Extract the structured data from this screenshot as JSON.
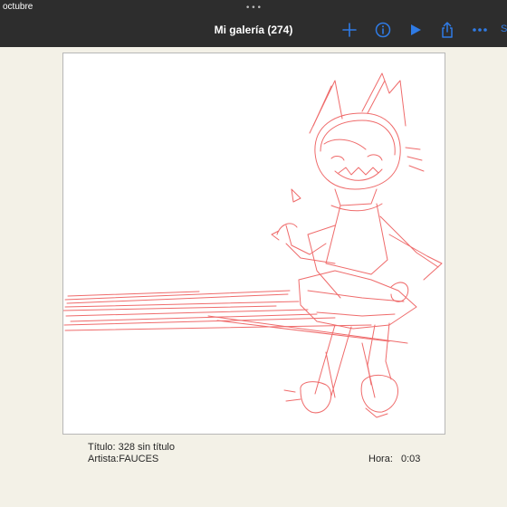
{
  "status_bar": {
    "left_label": "octubre",
    "center_dots": "•••"
  },
  "nav": {
    "title": "Mi galería (274)",
    "accent_color": "#2f7be5",
    "trailing_cut_text": "S",
    "icons": [
      "plus-icon",
      "info-icon",
      "play-icon",
      "share-icon",
      "more-icon"
    ]
  },
  "artwork": {
    "stroke_color": "#ef6b6b"
  },
  "details": {
    "title_line": "Título: 328 sin título",
    "artist_line": "Artista:FAUCES",
    "time_label": "Hora:",
    "time_value": "0:03"
  }
}
